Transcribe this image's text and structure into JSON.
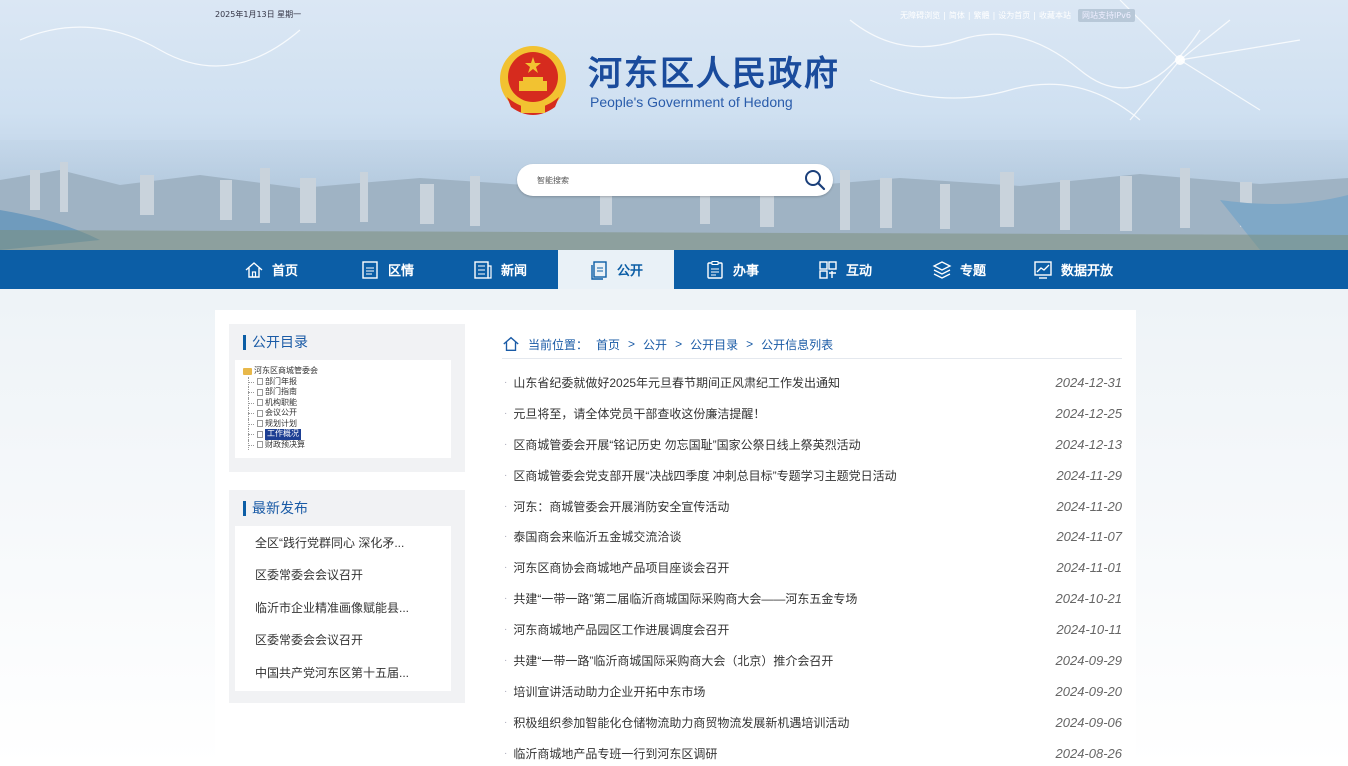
{
  "top": {
    "date": "2025年1月13日  星期一",
    "links": [
      "无障碍浏览",
      "简体",
      "繁體",
      "设为首页",
      "收藏本站"
    ],
    "ipv6": "网站支持IPv6"
  },
  "header": {
    "title": "河东区人民政府",
    "subtitle": "People's Government of Hedong"
  },
  "search": {
    "placeholder": "智能搜索"
  },
  "nav": {
    "items": [
      {
        "label": "首页",
        "icon": "home-icon"
      },
      {
        "label": "区情",
        "icon": "document-icon"
      },
      {
        "label": "新闻",
        "icon": "news-icon"
      },
      {
        "label": "公开",
        "icon": "open-files-icon"
      },
      {
        "label": "办事",
        "icon": "clipboard-icon"
      },
      {
        "label": "互动",
        "icon": "interaction-icon"
      },
      {
        "label": "专题",
        "icon": "layers-icon"
      },
      {
        "label": "数据开放",
        "icon": "data-icon"
      }
    ],
    "active_index": 3
  },
  "sidebar": {
    "catalog_title": "公开目录",
    "tree_root": "河东区商城管委会",
    "tree_items": [
      "部门年报",
      "部门指南",
      "机构职能",
      "会议公开",
      "规划计划",
      "工作概况",
      "财政预决算"
    ],
    "tree_selected": "工作概况",
    "latest_title": "最新发布",
    "latest_items": [
      "全区“践行党群同心 深化矛...",
      "区委常委会会议召开",
      "临沂市企业精准画像赋能县...",
      "区委常委会会议召开",
      "中国共产党河东区第十五届..."
    ]
  },
  "breadcrumb": {
    "label": "当前位置：",
    "crumbs": [
      "首页",
      "公开",
      "公开目录",
      "公开信息列表"
    ],
    "separator": ">"
  },
  "articles": [
    {
      "title": "山东省纪委就做好2025年元旦春节期间正风肃纪工作发出通知",
      "date": "2024-12-31"
    },
    {
      "title": "元旦将至，请全体党员干部查收这份廉洁提醒！",
      "date": "2024-12-25"
    },
    {
      "title": "区商城管委会开展“铭记历史 勿忘国耻”国家公祭日线上祭英烈活动",
      "date": "2024-12-13"
    },
    {
      "title": "区商城管委会党支部开展“决战四季度 冲刺总目标”专题学习主题党日活动",
      "date": "2024-11-29"
    },
    {
      "title": "河东：商城管委会开展消防安全宣传活动",
      "date": "2024-11-20"
    },
    {
      "title": "泰国商会来临沂五金城交流洽谈",
      "date": "2024-11-07"
    },
    {
      "title": "河东区商协会商城地产品项目座谈会召开",
      "date": "2024-11-01"
    },
    {
      "title": "共建“一带一路”第二届临沂商城国际采购商大会——河东五金专场",
      "date": "2024-10-21"
    },
    {
      "title": "河东商城地产品园区工作进展调度会召开",
      "date": "2024-10-11"
    },
    {
      "title": "共建“一带一路”临沂商城国际采购商大会（北京）推介会召开",
      "date": "2024-09-29"
    },
    {
      "title": "培训宣讲活动助力企业开拓中东市场",
      "date": "2024-09-20"
    },
    {
      "title": "积极组织参加智能化仓储物流助力商贸物流发展新机遇培训活动",
      "date": "2024-09-06"
    },
    {
      "title": "临沂商城地产品专班一行到河东区调研",
      "date": "2024-08-26"
    }
  ],
  "colors": {
    "nav_bg": "#0c5ea6",
    "title_blue": "#1a4b9c",
    "accent_blue": "#1a5ba6"
  }
}
